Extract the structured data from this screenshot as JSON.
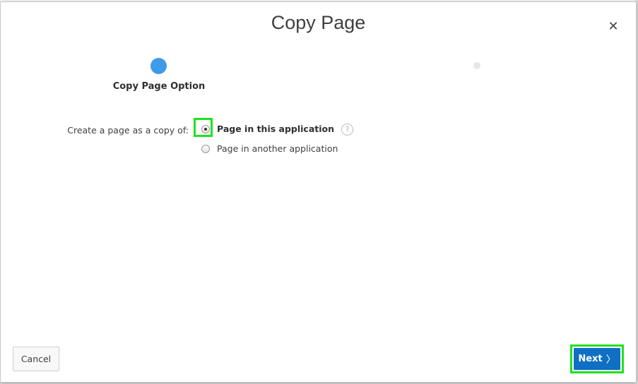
{
  "dialog": {
    "title": "Copy Page",
    "close_glyph": "✕"
  },
  "wizard": {
    "steps": [
      {
        "label": "Copy Page Option",
        "state": "active"
      },
      {
        "label": "",
        "state": "inactive"
      }
    ],
    "active_color": "#3d9be9"
  },
  "form": {
    "label": "Create a page as a copy of:",
    "options": [
      {
        "label": "Page in this application",
        "checked": true
      },
      {
        "label": "Page in another application",
        "checked": false
      }
    ],
    "help_glyph": "?"
  },
  "footer": {
    "cancel_label": "Cancel",
    "next_label": "Next",
    "next_glyph": "〉",
    "next_color": "#0f6fc5"
  },
  "highlight_color": "#1ee31e"
}
